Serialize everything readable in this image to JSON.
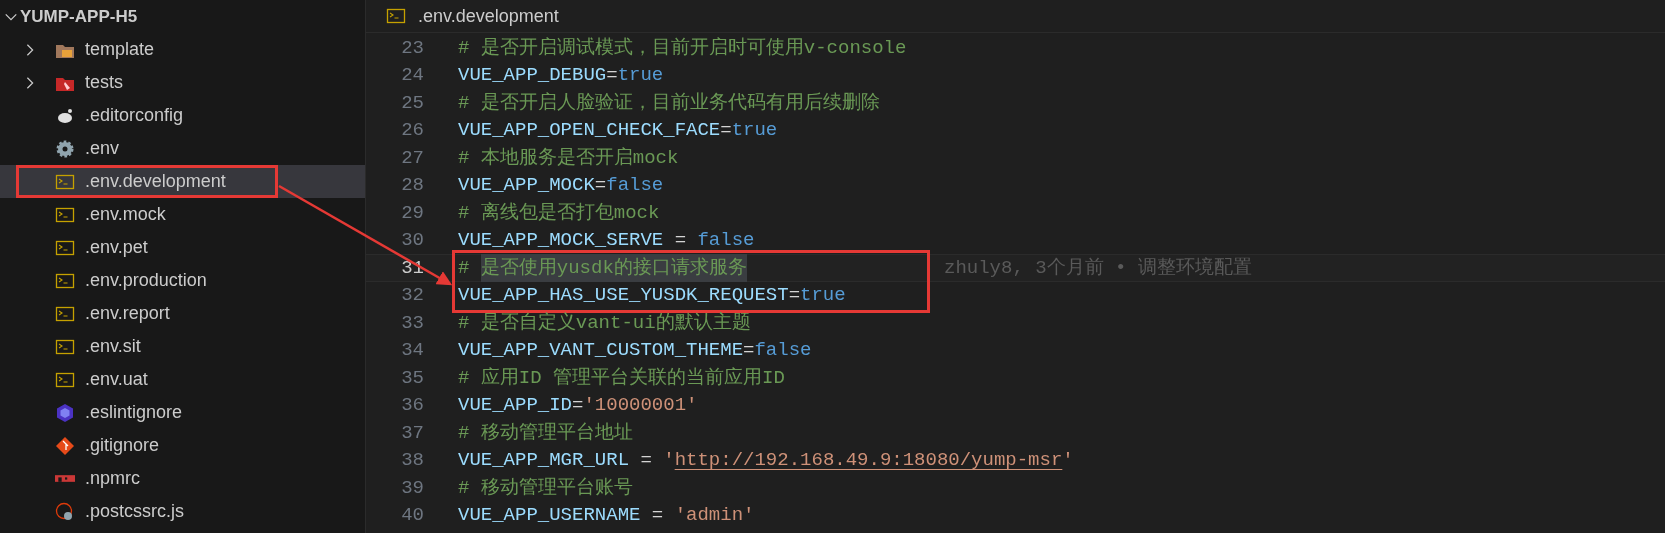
{
  "explorer": {
    "title": "YUMP-APP-H5",
    "expanded": true,
    "items": [
      {
        "label": "template",
        "kind": "templatefolder",
        "expanded": false,
        "selected": false,
        "annotated": false
      },
      {
        "label": "tests",
        "kind": "testfolder",
        "expanded": false,
        "selected": false,
        "annotated": false
      },
      {
        "label": ".editorconfig",
        "kind": "editorconfig",
        "selected": false,
        "annotated": false
      },
      {
        "label": ".env",
        "kind": "settings",
        "selected": false,
        "annotated": false
      },
      {
        "label": ".env.development",
        "kind": "env",
        "selected": true,
        "annotated": true
      },
      {
        "label": ".env.mock",
        "kind": "env",
        "selected": false,
        "annotated": false
      },
      {
        "label": ".env.pet",
        "kind": "env",
        "selected": false,
        "annotated": false
      },
      {
        "label": ".env.production",
        "kind": "env",
        "selected": false,
        "annotated": false
      },
      {
        "label": ".env.report",
        "kind": "env",
        "selected": false,
        "annotated": false
      },
      {
        "label": ".env.sit",
        "kind": "env",
        "selected": false,
        "annotated": false
      },
      {
        "label": ".env.uat",
        "kind": "env",
        "selected": false,
        "annotated": false
      },
      {
        "label": ".eslintignore",
        "kind": "eslint",
        "selected": false,
        "annotated": false
      },
      {
        "label": ".gitignore",
        "kind": "git",
        "selected": false,
        "annotated": false
      },
      {
        "label": ".npmrc",
        "kind": "npm",
        "selected": false,
        "annotated": false
      },
      {
        "label": ".postcssrc.js",
        "kind": "postcss",
        "selected": false,
        "annotated": false
      }
    ]
  },
  "editor": {
    "tab": {
      "label": ".env.development",
      "kind": "env"
    },
    "lines": [
      {
        "number": "23",
        "current": false,
        "annotated": false,
        "tokens": [
          {
            "kind": "comment",
            "text": "# 是否开启调试模式，目前开启时可使用v-console"
          }
        ]
      },
      {
        "number": "24",
        "current": false,
        "annotated": false,
        "tokens": [
          {
            "kind": "key",
            "text": "VUE_APP_DEBUG"
          },
          {
            "kind": "op",
            "text": "="
          },
          {
            "kind": "bool",
            "text": "true"
          }
        ]
      },
      {
        "number": "25",
        "current": false,
        "annotated": false,
        "tokens": [
          {
            "kind": "comment",
            "text": "# 是否开启人脸验证，目前业务代码有用后续删除"
          }
        ]
      },
      {
        "number": "26",
        "current": false,
        "annotated": false,
        "tokens": [
          {
            "kind": "key",
            "text": "VUE_APP_OPEN_CHECK_FACE"
          },
          {
            "kind": "op",
            "text": "="
          },
          {
            "kind": "bool",
            "text": "true"
          }
        ]
      },
      {
        "number": "27",
        "current": false,
        "annotated": false,
        "tokens": [
          {
            "kind": "comment",
            "text": "# 本地服务是否开启mock"
          }
        ]
      },
      {
        "number": "28",
        "current": false,
        "annotated": false,
        "tokens": [
          {
            "kind": "key",
            "text": "VUE_APP_MOCK"
          },
          {
            "kind": "op",
            "text": "="
          },
          {
            "kind": "bool",
            "text": "false"
          }
        ]
      },
      {
        "number": "29",
        "current": false,
        "annotated": false,
        "tokens": [
          {
            "kind": "comment",
            "text": "# 离线包是否打包mock"
          }
        ]
      },
      {
        "number": "30",
        "current": false,
        "annotated": false,
        "tokens": [
          {
            "kind": "key",
            "text": "VUE_APP_MOCK_SERVE"
          },
          {
            "kind": "op",
            "text": " = "
          },
          {
            "kind": "bool",
            "text": "false"
          }
        ]
      },
      {
        "number": "31",
        "current": true,
        "annotated": true,
        "blame": "zhuly8, 3个月前 • 调整环境配置",
        "tokens": [
          {
            "kind": "comment",
            "text": "# "
          },
          {
            "kind": "comment-selected",
            "text": "是否使用yusdk的接口请求服务"
          }
        ]
      },
      {
        "number": "32",
        "current": false,
        "annotated": true,
        "tokens": [
          {
            "kind": "key",
            "text": "VUE_APP_HAS_USE_YUSDK_REQUEST"
          },
          {
            "kind": "op",
            "text": "="
          },
          {
            "kind": "bool",
            "text": "true"
          }
        ]
      },
      {
        "number": "33",
        "current": false,
        "annotated": false,
        "tokens": [
          {
            "kind": "comment",
            "text": "# 是否自定义vant-ui的默认主题"
          }
        ]
      },
      {
        "number": "34",
        "current": false,
        "annotated": false,
        "tokens": [
          {
            "kind": "key",
            "text": "VUE_APP_VANT_CUSTOM_THEME"
          },
          {
            "kind": "op",
            "text": "="
          },
          {
            "kind": "bool",
            "text": "false"
          }
        ]
      },
      {
        "number": "35",
        "current": false,
        "annotated": false,
        "tokens": [
          {
            "kind": "comment",
            "text": "# 应用ID 管理平台关联的当前应用ID"
          }
        ]
      },
      {
        "number": "36",
        "current": false,
        "annotated": false,
        "tokens": [
          {
            "kind": "key",
            "text": "VUE_APP_ID"
          },
          {
            "kind": "op",
            "text": "="
          },
          {
            "kind": "string",
            "text": "'10000001'"
          }
        ]
      },
      {
        "number": "37",
        "current": false,
        "annotated": false,
        "tokens": [
          {
            "kind": "comment",
            "text": "# 移动管理平台地址"
          }
        ]
      },
      {
        "number": "38",
        "current": false,
        "annotated": false,
        "tokens": [
          {
            "kind": "key",
            "text": "VUE_APP_MGR_URL"
          },
          {
            "kind": "op",
            "text": " = "
          },
          {
            "kind": "string",
            "text": "'"
          },
          {
            "kind": "link",
            "text": "http://192.168.49.9:18080/yump-msr"
          },
          {
            "kind": "string",
            "text": "'"
          }
        ]
      },
      {
        "number": "39",
        "current": false,
        "annotated": false,
        "tokens": [
          {
            "kind": "comment",
            "text": "# 移动管理平台账号"
          }
        ]
      },
      {
        "number": "40",
        "current": false,
        "annotated": false,
        "tokens": [
          {
            "kind": "key",
            "text": "VUE_APP_USERNAME"
          },
          {
            "kind": "op",
            "text": " = "
          },
          {
            "kind": "string",
            "text": "'admin'"
          }
        ]
      }
    ]
  }
}
